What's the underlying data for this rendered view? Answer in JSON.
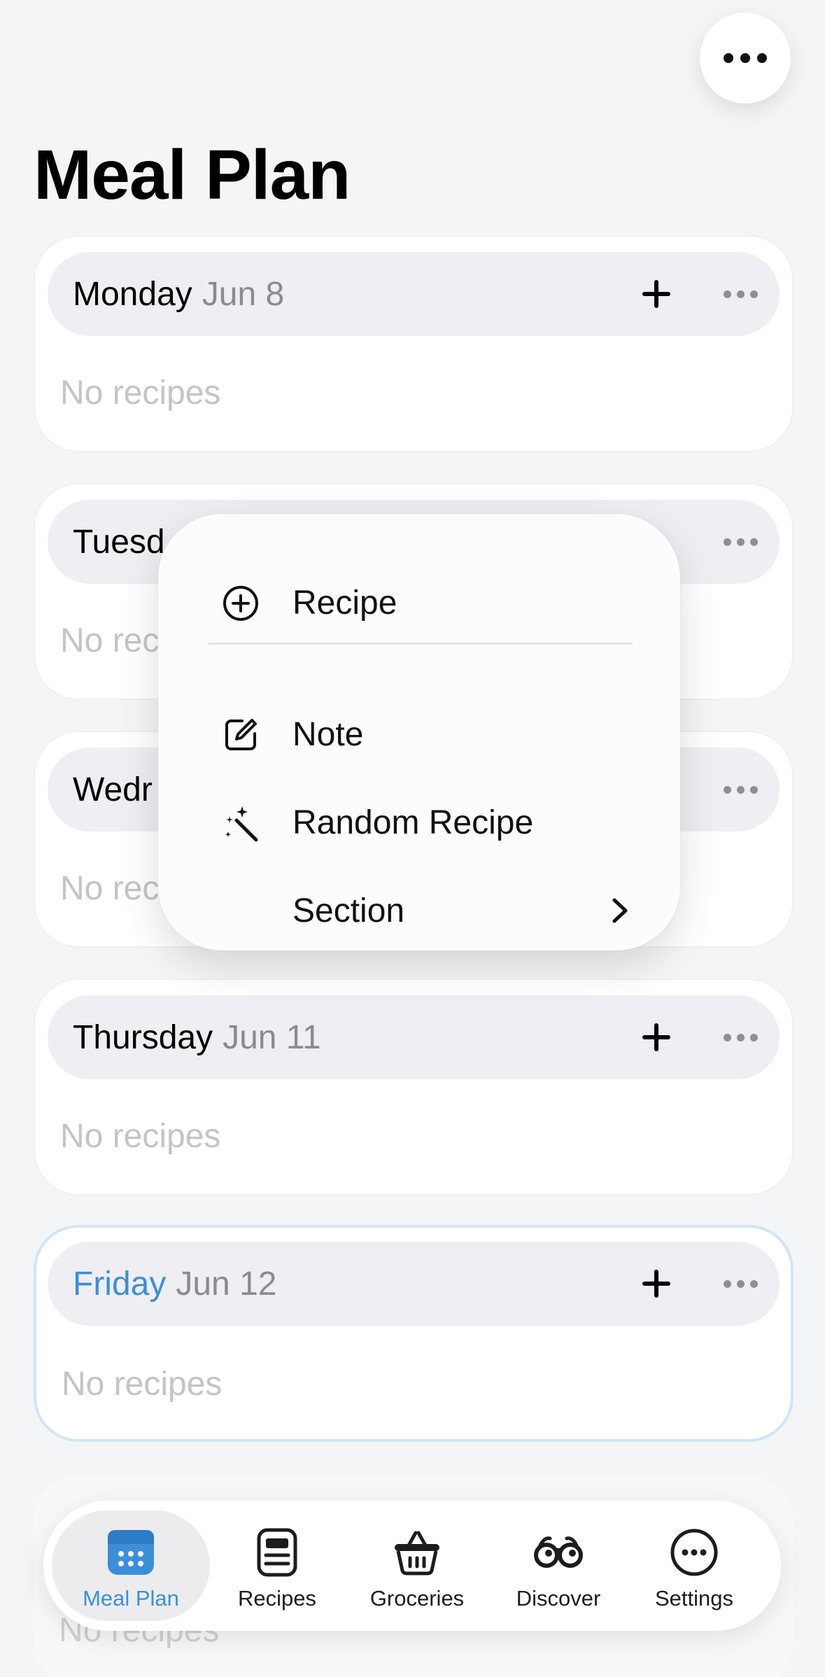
{
  "page": {
    "title": "Meal Plan"
  },
  "days": [
    {
      "name": "Monday",
      "date": "Jun 8",
      "empty_text": "No recipes",
      "today": false
    },
    {
      "name": "Tuesd",
      "date": "",
      "empty_text": "No rec",
      "today": false
    },
    {
      "name": "Wedr",
      "date": "",
      "empty_text": "No rec",
      "today": false
    },
    {
      "name": "Thursday",
      "date": "Jun 11",
      "empty_text": "No recipes",
      "today": false
    },
    {
      "name": "Friday",
      "date": "Jun 12",
      "empty_text": "No recipes",
      "today": true
    }
  ],
  "peek": {
    "empty_text": "No recipes"
  },
  "menu": {
    "items": [
      {
        "label": "Recipe",
        "icon": "plus-circle-icon"
      },
      {
        "label": "Note",
        "icon": "edit-note-icon"
      },
      {
        "label": "Random Recipe",
        "icon": "magic-wand-icon"
      },
      {
        "label": "Section",
        "icon": "chevron-right-icon"
      }
    ]
  },
  "tabs": [
    {
      "label": "Meal Plan",
      "icon": "calendar-icon",
      "active": true
    },
    {
      "label": "Recipes",
      "icon": "recipe-card-icon",
      "active": false
    },
    {
      "label": "Groceries",
      "icon": "basket-icon",
      "active": false
    },
    {
      "label": "Discover",
      "icon": "binoculars-icon",
      "active": false
    },
    {
      "label": "Settings",
      "icon": "ellipsis-circle-icon",
      "active": false
    }
  ],
  "colors": {
    "accent": "#3b8fd9",
    "background": "#f4f5f6",
    "header_pill": "#efeff3",
    "muted_text": "#c4c4c7",
    "date_text": "#8a8a8f"
  }
}
